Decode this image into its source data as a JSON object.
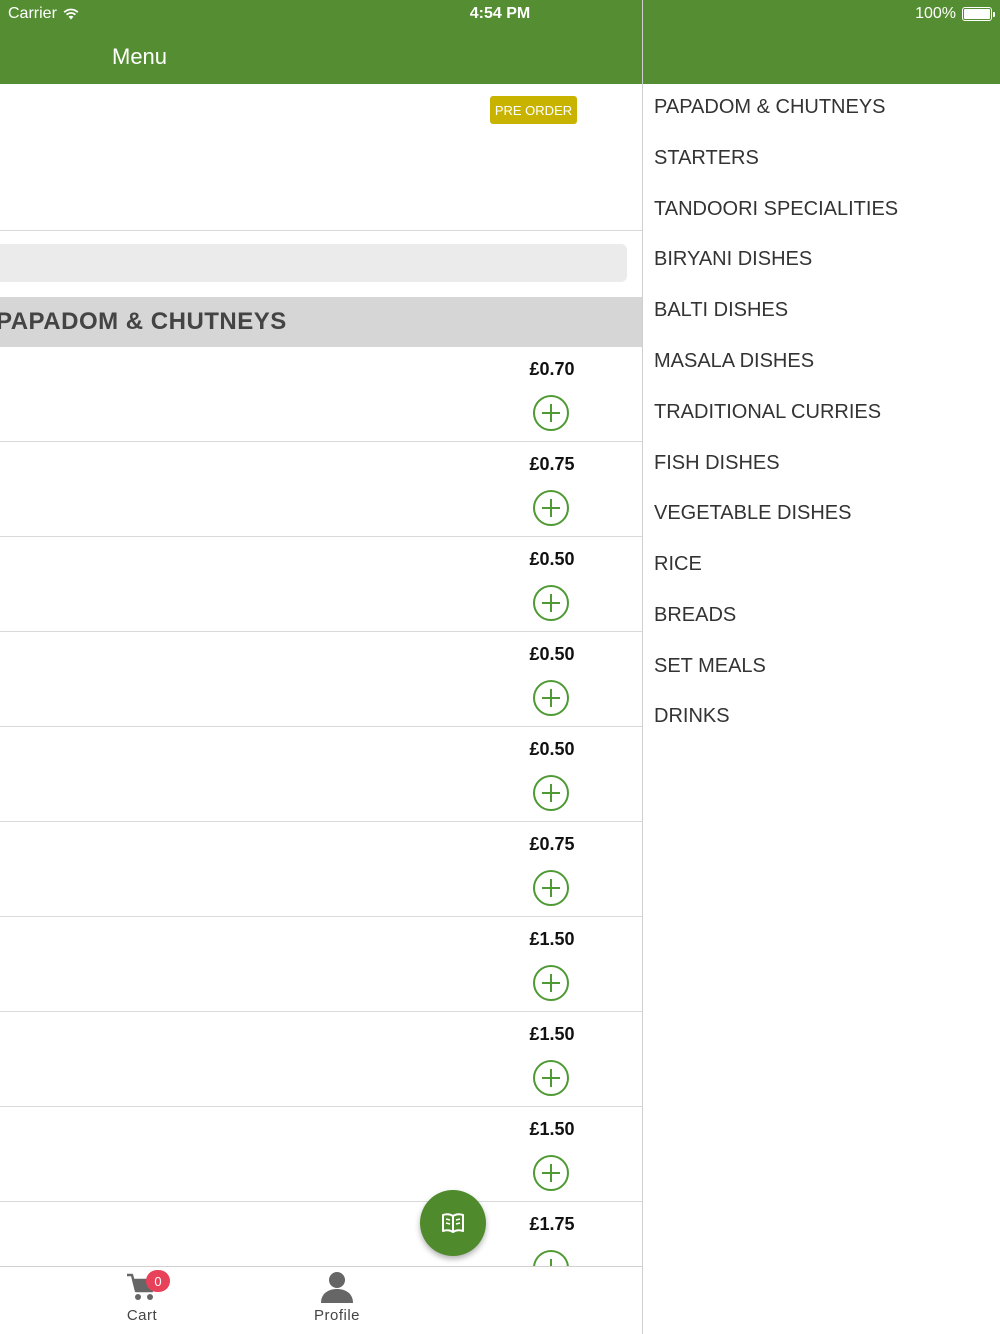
{
  "status_bar": {
    "carrier": "Carrier",
    "time": "4:54 PM",
    "battery": "100%"
  },
  "header": {
    "title": "Menu"
  },
  "main": {
    "preorder_label": "PRE ORDER",
    "category_title": "PAPADOM & CHUTNEYS",
    "items": [
      {
        "price": "£0.70"
      },
      {
        "price": "£0.75"
      },
      {
        "price": "£0.50"
      },
      {
        "price": "£0.50"
      },
      {
        "price": "£0.50"
      },
      {
        "price": "£0.75"
      },
      {
        "price": "£1.50"
      },
      {
        "price": "£1.50"
      },
      {
        "price": "£1.50"
      },
      {
        "price": "£1.75"
      }
    ]
  },
  "tabbar": {
    "cart": {
      "label": "Cart",
      "badge": "0",
      "icon": "cart-icon"
    },
    "profile": {
      "label": "Profile",
      "icon": "profile-icon"
    }
  },
  "categories": [
    "PAPADOM & CHUTNEYS",
    "STARTERS",
    "TANDOORI SPECIALITIES",
    "BIRYANI DISHES",
    "BALTI DISHES",
    "MASALA DISHES",
    "TRADITIONAL CURRIES",
    "FISH DISHES",
    "VEGETABLE DISHES",
    "RICE",
    "BREADS",
    "SET MEALS",
    "DRINKS"
  ],
  "colors": {
    "header": "#558e32",
    "accent": "#4f9a34",
    "preorder": "#c8b400",
    "badge": "#e8415a"
  }
}
